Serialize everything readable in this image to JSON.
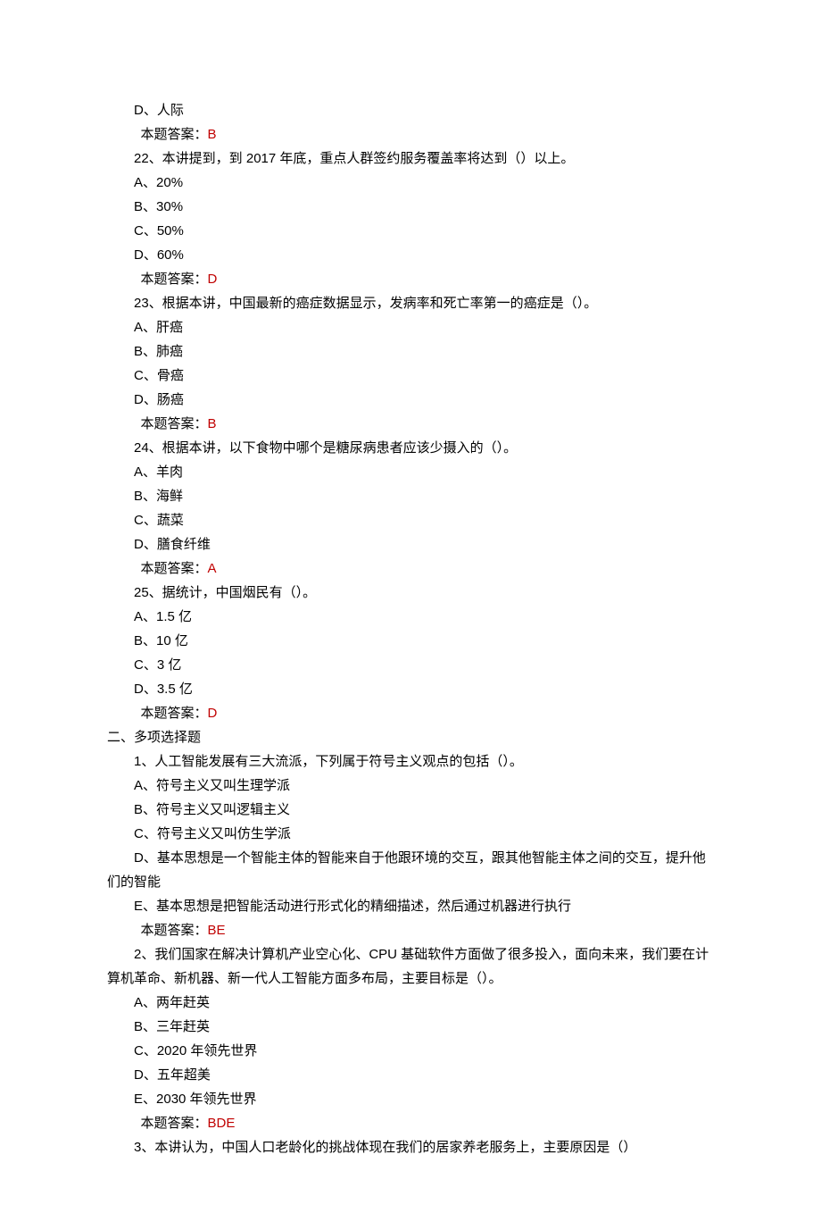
{
  "lines": [
    {
      "cls": "indent-opt",
      "parts": [
        {
          "t": "D、人际"
        }
      ]
    },
    {
      "cls": "indent-answer",
      "parts": [
        {
          "t": "本题答案："
        },
        {
          "t": "B",
          "red": true
        }
      ]
    },
    {
      "cls": "indent-q",
      "parts": [
        {
          "t": "22、本讲提到，到 2017 年底，重点人群签约服务覆盖率将达到（）以上。"
        }
      ]
    },
    {
      "cls": "indent-opt",
      "parts": [
        {
          "t": "A、20%"
        }
      ]
    },
    {
      "cls": "indent-opt",
      "parts": [
        {
          "t": "B、30%"
        }
      ]
    },
    {
      "cls": "indent-opt",
      "parts": [
        {
          "t": "C、50%"
        }
      ]
    },
    {
      "cls": "indent-opt",
      "parts": [
        {
          "t": "D、60%"
        }
      ]
    },
    {
      "cls": "indent-answer",
      "parts": [
        {
          "t": "本题答案："
        },
        {
          "t": "D",
          "red": true
        }
      ]
    },
    {
      "cls": "indent-q",
      "parts": [
        {
          "t": "23、根据本讲，中国最新的癌症数据显示，发病率和死亡率第一的癌症是（）。"
        }
      ]
    },
    {
      "cls": "indent-opt",
      "parts": [
        {
          "t": "A、肝癌"
        }
      ]
    },
    {
      "cls": "indent-opt",
      "parts": [
        {
          "t": "B、肺癌"
        }
      ]
    },
    {
      "cls": "indent-opt",
      "parts": [
        {
          "t": "C、骨癌"
        }
      ]
    },
    {
      "cls": "indent-opt",
      "parts": [
        {
          "t": "D、肠癌"
        }
      ]
    },
    {
      "cls": "indent-answer",
      "parts": [
        {
          "t": "本题答案："
        },
        {
          "t": "B",
          "red": true
        }
      ]
    },
    {
      "cls": "indent-q",
      "parts": [
        {
          "t": "24、根据本讲，以下食物中哪个是糖尿病患者应该少摄入的（）。"
        }
      ]
    },
    {
      "cls": "indent-opt",
      "parts": [
        {
          "t": "A、羊肉"
        }
      ]
    },
    {
      "cls": "indent-opt",
      "parts": [
        {
          "t": "B、海鲜"
        }
      ]
    },
    {
      "cls": "indent-opt",
      "parts": [
        {
          "t": "C、蔬菜"
        }
      ]
    },
    {
      "cls": "indent-opt",
      "parts": [
        {
          "t": "D、膳食纤维"
        }
      ]
    },
    {
      "cls": "indent-answer",
      "parts": [
        {
          "t": "本题答案："
        },
        {
          "t": "A",
          "red": true
        }
      ]
    },
    {
      "cls": "indent-q",
      "parts": [
        {
          "t": "25、据统计，中国烟民有（）。"
        }
      ]
    },
    {
      "cls": "indent-opt",
      "parts": [
        {
          "t": "A、1.5 亿"
        }
      ]
    },
    {
      "cls": "indent-opt",
      "parts": [
        {
          "t": "B、10 亿"
        }
      ]
    },
    {
      "cls": "indent-opt",
      "parts": [
        {
          "t": "C、3 亿"
        }
      ]
    },
    {
      "cls": "indent-opt",
      "parts": [
        {
          "t": "D、3.5 亿"
        }
      ]
    },
    {
      "cls": "indent-answer",
      "parts": [
        {
          "t": "本题答案："
        },
        {
          "t": "D",
          "red": true
        }
      ]
    },
    {
      "cls": "section",
      "parts": [
        {
          "t": "二、多项选择题"
        }
      ]
    },
    {
      "cls": "indent-q",
      "parts": [
        {
          "t": "1、人工智能发展有三大流派，下列属于符号主义观点的包括（）。"
        }
      ]
    },
    {
      "cls": "indent-opt",
      "parts": [
        {
          "t": "A、符号主义又叫生理学派"
        }
      ]
    },
    {
      "cls": "indent-opt",
      "parts": [
        {
          "t": "B、符号主义又叫逻辑主义"
        }
      ]
    },
    {
      "cls": "indent-opt",
      "parts": [
        {
          "t": "C、符号主义又叫仿生学派"
        }
      ]
    },
    {
      "cls": "indent-q",
      "parts": [
        {
          "t": "D、基本思想是一个智能主体的智能来自于他跟环境的交互，跟其他智能主体之间的交互，提升他们的智能"
        }
      ],
      "flush": true
    },
    {
      "cls": "indent-opt",
      "parts": [
        {
          "t": "E、基本思想是把智能活动进行形式化的精细描述，然后通过机器进行执行"
        }
      ]
    },
    {
      "cls": "indent-answer",
      "parts": [
        {
          "t": "本题答案："
        },
        {
          "t": "BE",
          "red": true
        }
      ]
    },
    {
      "cls": "indent-q",
      "parts": [
        {
          "t": "2、我们国家在解决计算机产业空心化、CPU 基础软件方面做了很多投入，面向未来，我们要在计算机革命、新机器、新一代人工智能方面多布局，主要目标是（）。"
        }
      ],
      "flush": true
    },
    {
      "cls": "indent-opt",
      "parts": [
        {
          "t": "A、两年赶英"
        }
      ]
    },
    {
      "cls": "indent-opt",
      "parts": [
        {
          "t": "B、三年赶英"
        }
      ]
    },
    {
      "cls": "indent-opt",
      "parts": [
        {
          "t": "C、2020 年领先世界"
        }
      ]
    },
    {
      "cls": "indent-opt",
      "parts": [
        {
          "t": "D、五年超美"
        }
      ]
    },
    {
      "cls": "indent-opt",
      "parts": [
        {
          "t": "E、2030 年领先世界"
        }
      ]
    },
    {
      "cls": "indent-answer",
      "parts": [
        {
          "t": "本题答案："
        },
        {
          "t": "BDE",
          "red": true
        }
      ]
    },
    {
      "cls": "indent-q",
      "parts": [
        {
          "t": "3、本讲认为，中国人口老龄化的挑战体现在我们的居家养老服务上，主要原因是（）"
        }
      ]
    }
  ]
}
